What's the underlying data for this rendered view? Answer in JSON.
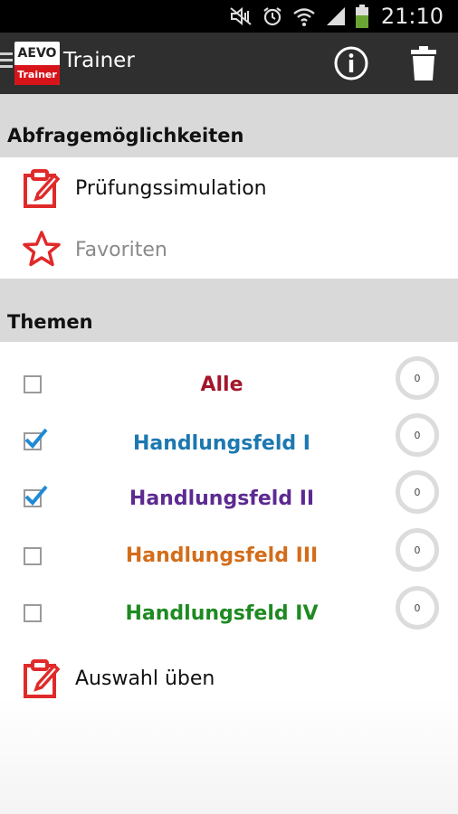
{
  "status_bar": {
    "time": "21:10",
    "icons": [
      "mute-icon",
      "alarm-icon",
      "wifi-icon",
      "signal-icon",
      "battery-icon"
    ]
  },
  "action_bar": {
    "logo_top": "AEVO",
    "logo_bottom": "Trainer",
    "title": "Trainer",
    "icons": [
      "info-icon",
      "trash-icon"
    ]
  },
  "query_section": {
    "title": "Abfragemöglichkeiten",
    "items": [
      {
        "label": "Prüfungssimulation",
        "icon": "clipboard-edit-icon",
        "color": "#111111"
      },
      {
        "label": "Favoriten",
        "icon": "star-icon",
        "color": "#8a8a8a"
      }
    ]
  },
  "topics_section": {
    "title": "Themen",
    "topics": [
      {
        "label": "Alle",
        "checked": false,
        "color": "#a3162a",
        "count": "0"
      },
      {
        "label": "Handlungsfeld I",
        "checked": true,
        "color": "#1c78b0",
        "count": "0"
      },
      {
        "label": "Handlungsfeld II",
        "checked": true,
        "color": "#5c2a91",
        "count": "0"
      },
      {
        "label": "Handlungsfeld III",
        "checked": false,
        "color": "#d36d1a",
        "count": "0"
      },
      {
        "label": "Handlungsfeld IV",
        "checked": false,
        "color": "#1e8a22",
        "count": "0"
      }
    ],
    "practice": {
      "label": "Auswahl üben",
      "icon": "clipboard-edit-icon"
    }
  },
  "colors": {
    "accent_red": "#e02a2a",
    "action_bar": "#2f2f2f",
    "section_header": "#d9d9d9",
    "checkbox_tick": "#1f8ad6"
  }
}
